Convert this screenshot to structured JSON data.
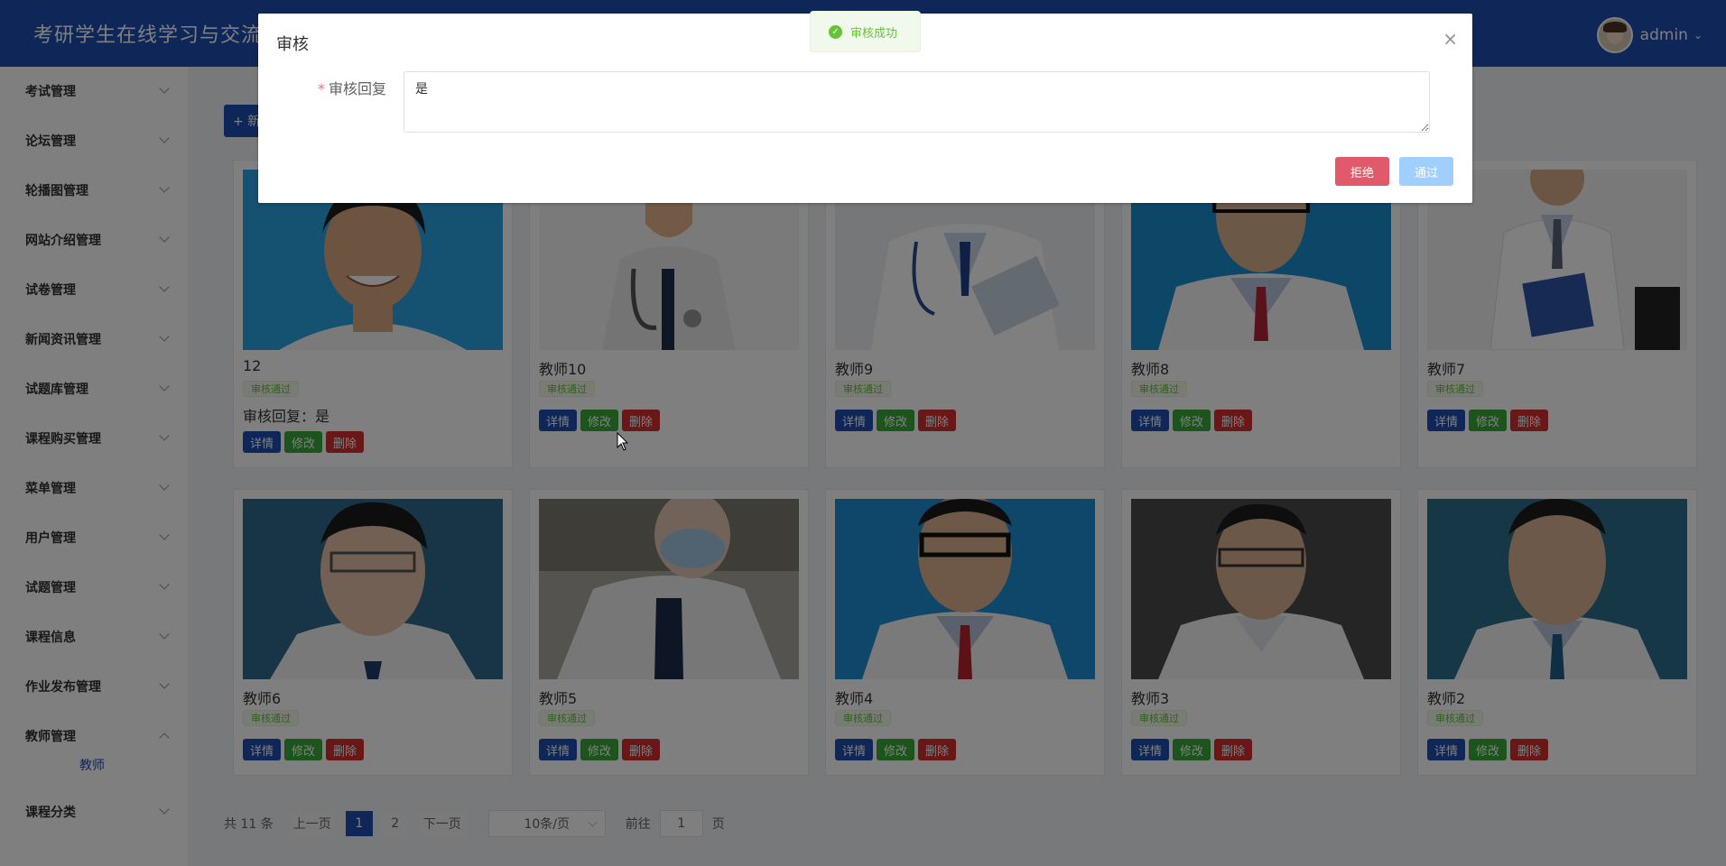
{
  "header": {
    "title": "考研学生在线学习与交流系统",
    "username": "admin"
  },
  "sidebar": {
    "items": [
      {
        "label": "考试管理"
      },
      {
        "label": "论坛管理"
      },
      {
        "label": "轮播图管理"
      },
      {
        "label": "网站介绍管理"
      },
      {
        "label": "试卷管理"
      },
      {
        "label": "新闻资讯管理"
      },
      {
        "label": "试题库管理"
      },
      {
        "label": "课程购买管理"
      },
      {
        "label": "菜单管理"
      },
      {
        "label": "用户管理"
      },
      {
        "label": "试题管理"
      },
      {
        "label": "课程信息"
      },
      {
        "label": "作业发布管理"
      },
      {
        "label": "教师管理"
      },
      {
        "label": "课程分类"
      }
    ],
    "sub_item": "教师"
  },
  "main": {
    "add_button": "+ 新增",
    "cards": [
      {
        "name": "12",
        "status": "审核通过",
        "reply": "审核回复：是"
      },
      {
        "name": "教师10",
        "status": "审核通过"
      },
      {
        "name": "教师9",
        "status": "审核通过"
      },
      {
        "name": "教师8",
        "status": "审核通过"
      },
      {
        "name": "教师7",
        "status": "审核通过"
      },
      {
        "name": "教师6",
        "status": "审核通过"
      },
      {
        "name": "教师5",
        "status": "审核通过"
      },
      {
        "name": "教师4",
        "status": "审核通过"
      },
      {
        "name": "教师3",
        "status": "审核通过"
      },
      {
        "name": "教师2",
        "status": "审核通过"
      }
    ],
    "buttons": {
      "detail": "详情",
      "edit": "修改",
      "delete": "删除"
    }
  },
  "pagination": {
    "total": "共 11 条",
    "prev": "上一页",
    "pages": [
      "1",
      "2"
    ],
    "next": "下一页",
    "page_size": "10条/页",
    "goto_label": "前往",
    "goto_value": "1",
    "page_suffix": "页"
  },
  "dialog": {
    "title": "审核",
    "label": "审核回复",
    "textarea_value": "是",
    "reject": "拒绝",
    "pass": "通过",
    "close": "×"
  },
  "toast": {
    "message": "审核成功"
  }
}
